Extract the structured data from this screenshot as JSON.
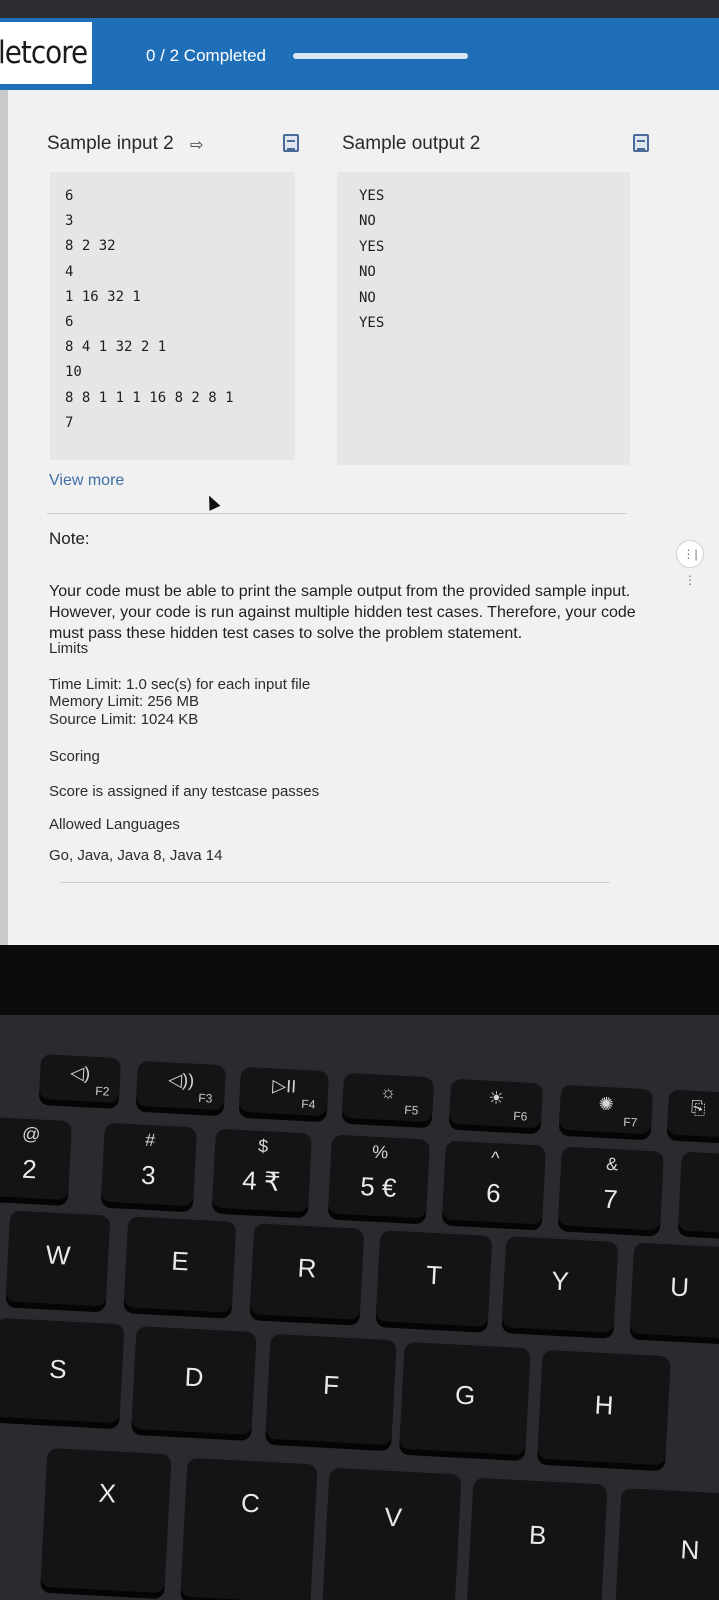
{
  "header": {
    "logo": "letcore",
    "progress_text": "0 / 2 Completed",
    "progress_value": 0
  },
  "sample_input": {
    "title": "Sample input 2",
    "lines": [
      "6",
      "3",
      "8 2 32",
      "4",
      "1 16 32 1",
      "6",
      "8 4 1 32 2 1",
      "10",
      "8 8 1 1 1 16 8 2 8 1",
      "7"
    ]
  },
  "sample_output": {
    "title": "Sample output 2",
    "lines": [
      "YES",
      "NO",
      "YES",
      "NO",
      "NO",
      "YES"
    ]
  },
  "view_more": "View more",
  "note": {
    "title": "Note:",
    "text": "Your code must be able to print the sample output from the provided sample input. However, your code is run against multiple hidden test cases. Therefore, your code must pass these hidden test cases to solve the problem statement."
  },
  "limits": {
    "title": "Limits",
    "time": "Time Limit: 1.0 sec(s) for each input file",
    "memory": "Memory Limit: 256 MB",
    "source": "Source Limit: 1024 KB"
  },
  "scoring": {
    "title": "Scoring",
    "text": "Score is assigned if any testcase passes"
  },
  "languages": {
    "title": "Allowed Languages",
    "text": "Go, Java, Java 8, Java 14"
  },
  "keyboard": {
    "fn_keys": [
      {
        "label": "F2",
        "icon": "volume-down-icon"
      },
      {
        "label": "F3",
        "icon": "volume-up-icon"
      },
      {
        "label": "F4",
        "icon": "play-pause-icon"
      },
      {
        "label": "F5",
        "icon": "brightness-down-icon"
      },
      {
        "label": "F6",
        "icon": "brightness-up-icon"
      },
      {
        "label": "F7",
        "icon": "sun-icon"
      }
    ],
    "number_keys": [
      {
        "main": "2",
        "sym": "@"
      },
      {
        "main": "3",
        "sym": "#"
      },
      {
        "main": "4 ₹",
        "sym": "$"
      },
      {
        "main": "5 €",
        "sym": "%"
      },
      {
        "main": "6",
        "sym": "^"
      },
      {
        "main": "7",
        "sym": "&"
      }
    ],
    "row_qwerty": [
      "W",
      "E",
      "R",
      "T",
      "Y",
      "U"
    ],
    "row_home": [
      "S",
      "D",
      "F",
      "G",
      "H"
    ],
    "row_bottom": [
      "X",
      "C",
      "V",
      "B",
      "N"
    ]
  }
}
